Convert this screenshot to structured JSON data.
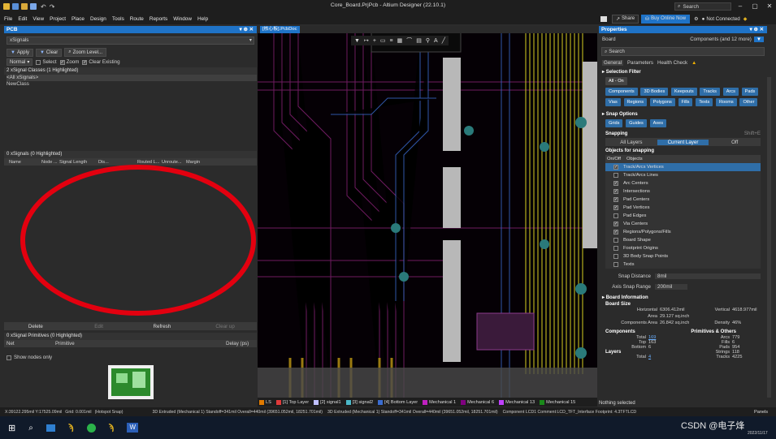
{
  "window": {
    "title": "Core_Board.PrjPcb - Altium Designer (22.10.1)",
    "search_placeholder": "Search",
    "controls": [
      "‒",
      "▢",
      "✕"
    ]
  },
  "menu": [
    "File",
    "Edit",
    "View",
    "Project",
    "Place",
    "Design",
    "Tools",
    "Route",
    "Reports",
    "Window",
    "Help"
  ],
  "top_right": {
    "share": "Share",
    "buy": "Buy Online Now",
    "connection": "Not Connected"
  },
  "pcb_panel": {
    "title": "PCB",
    "mode": "xSignals",
    "apply": "Apply",
    "clear": "Clear",
    "zoom": "Zoom Level...",
    "normal": "Normal",
    "select": "Select",
    "zoom_opt": "Zoom",
    "clear_existing": "Clear Existing",
    "classes_header": "2 xSignal Classes (1 Highlighted)",
    "classes": [
      "<All xSignals>",
      "NewClass"
    ],
    "signals_header": "0 xSignals (0 Highlighted)",
    "columns": [
      "Name",
      "Node ...",
      "Signal Length",
      "Dis...",
      "Routed L...",
      "Unroute...",
      "Margin"
    ],
    "buttons": [
      "Delete",
      "Edit",
      "Refresh",
      "Clear up"
    ],
    "primitives_header": "0 xSignal Primitives (0 Highlighted)",
    "prim_columns": [
      "Net",
      "Primitive",
      "Delay (ps)"
    ],
    "show_nodes": "Show nodes only"
  },
  "doc_tab": "[核心板].PcbDoc",
  "layers": [
    {
      "name": "LS",
      "color": "#e07a00"
    },
    {
      "name": "[1] Top Layer",
      "color": "#e03a3a"
    },
    {
      "name": "[2] signal1",
      "color": "#c0c0ff"
    },
    {
      "name": "[3] signal2",
      "color": "#4bb8c8"
    },
    {
      "name": "[4] Bottom Layer",
      "color": "#3a6cd0"
    },
    {
      "name": "Mechanical 1",
      "color": "#c020c0"
    },
    {
      "name": "Mechanical 6",
      "color": "#800080"
    },
    {
      "name": "Mechanical 13",
      "color": "#c040ff"
    },
    {
      "name": "Mechanical 15",
      "color": "#1a8a1a"
    }
  ],
  "properties": {
    "title": "Properties",
    "board": "Board",
    "components_filter": "Components (and 12 more)",
    "search": "Search",
    "tabs": [
      "General",
      "Parameters",
      "Health Check"
    ],
    "selection_filter": "Selection Filter",
    "all_on": "All - On",
    "filter_chips": [
      "Components",
      "3D Bodies",
      "Keepouts",
      "Tracks",
      "Arcs",
      "Pads",
      "Vias",
      "Regions",
      "Polygons",
      "Fills",
      "Texts",
      "Rooms",
      "Other"
    ],
    "snap_options": "Snap Options",
    "snap_chips": [
      "Grids",
      "Guides",
      "Axes"
    ],
    "snapping": "Snapping",
    "snapping_shortcut": "Shift+E",
    "snap_modes": [
      "All Layers",
      "Current Layer",
      "Off"
    ],
    "objects_for_snapping": "Objects for snapping",
    "obj_cols": [
      "On/Off",
      "Objects"
    ],
    "snap_objects": [
      {
        "label": "Track/Arcs Vertices",
        "on": true,
        "sel": true
      },
      {
        "label": "Track/Arcs Lines",
        "on": false
      },
      {
        "label": "Arc Centers",
        "on": true
      },
      {
        "label": "Intersections",
        "on": true
      },
      {
        "label": "Pad Centers",
        "on": true
      },
      {
        "label": "Pad Vertices",
        "on": true
      },
      {
        "label": "Pad Edges",
        "on": false
      },
      {
        "label": "Via Centers",
        "on": true
      },
      {
        "label": "Regions/Polygons/Fills",
        "on": true
      },
      {
        "label": "Board Shape",
        "on": false
      },
      {
        "label": "Footprint Origins",
        "on": false
      },
      {
        "label": "3D Body Snap Points",
        "on": false
      },
      {
        "label": "Texts",
        "on": false
      }
    ],
    "snap_distance_label": "Snap Distance",
    "snap_distance": "8mil",
    "axis_snap_label": "Axis Snap Range",
    "axis_snap": "200mil",
    "board_info": "Board Information",
    "board_size": "Board Size",
    "horizontal_label": "Horizontal",
    "horizontal": "6306.412mil",
    "vertical_label": "Vertical",
    "vertical": "4618.977mil",
    "area_label": "Area",
    "area": "29.127 sq.inch",
    "comp_area_label": "Components Area",
    "comp_area": "26.842 sq.inch",
    "density_label": "Density",
    "density": "46%",
    "components": "Components",
    "primitives": "Primitives & Others",
    "total_label": "Total",
    "total": "169",
    "top_label": "Top",
    "top": "163",
    "bottom_label": "Bottom",
    "bottom": "6",
    "arcs_label": "Arcs",
    "arcs": "779",
    "fills_label": "Fills",
    "fills": "6",
    "pads_label": "Pads",
    "pads": "954",
    "strings_label": "Strings",
    "strings": "118",
    "tracks_label": "Tracks",
    "tracks": "4225",
    "layers_label": "Layers",
    "layers_total_label": "Total",
    "layers_total": "4",
    "nothing_selected": "Nothing selected",
    "panels": "Panels"
  },
  "status": {
    "coords": "X:39122.295mil Y:17525.09mil",
    "grid": "Grid: 0.001mil",
    "snap": "(Hotspot Snap)",
    "info1": "3D Extruded (Mechanical 1) Standoff=341mil Overall=440mil (39651.052mil, 18251.701mil)",
    "info2": "3D Extruded (Mechanical 1) Standoff=341mil Overall=440mil (39651.052mil, 18251.701mil)",
    "info3": "Component LCD1 Comment:LCD_TFT_Interface Footprint: 4.3TFTLCD"
  },
  "watermark": "CSDN @电子烽",
  "clock": "2022/11/17",
  "colors": {
    "accent": "#1f73c7",
    "board_bg": "#000000",
    "panel_bg": "#2b2b2b",
    "ellipse": "#e3000f"
  }
}
